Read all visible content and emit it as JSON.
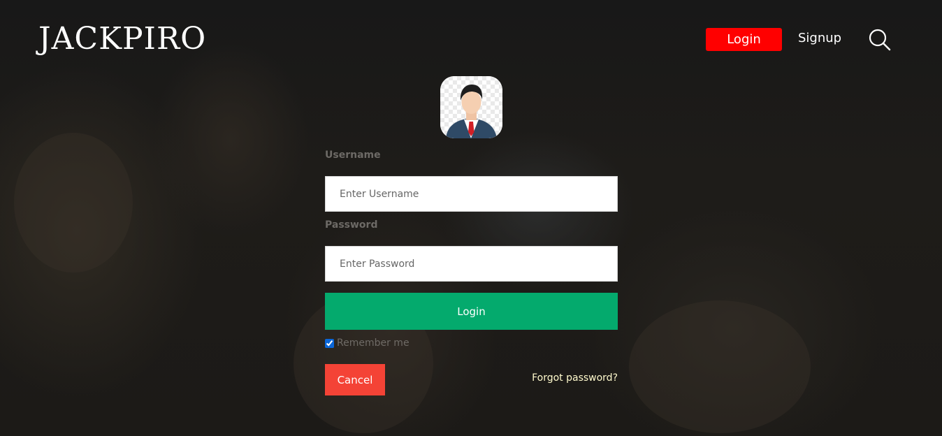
{
  "header": {
    "logo": "JACKPIRO",
    "login_label": "Login",
    "signup_label": "Signup",
    "search_icon": "search-icon"
  },
  "avatar": {
    "icon": "user-avatar-icon"
  },
  "form": {
    "username_label": "Username",
    "username_placeholder": "Enter Username",
    "password_label": "Password",
    "password_placeholder": "Enter Password",
    "submit_label": "Login",
    "remember_label": "Remember me",
    "remember_checked": true,
    "cancel_label": "Cancel",
    "forgot_label": "Forgot password?"
  },
  "colors": {
    "nav_login_bg": "#ff0000",
    "submit_bg": "#04aa6d",
    "cancel_bg": "#f44336",
    "forgot_text": "#fffacd"
  }
}
